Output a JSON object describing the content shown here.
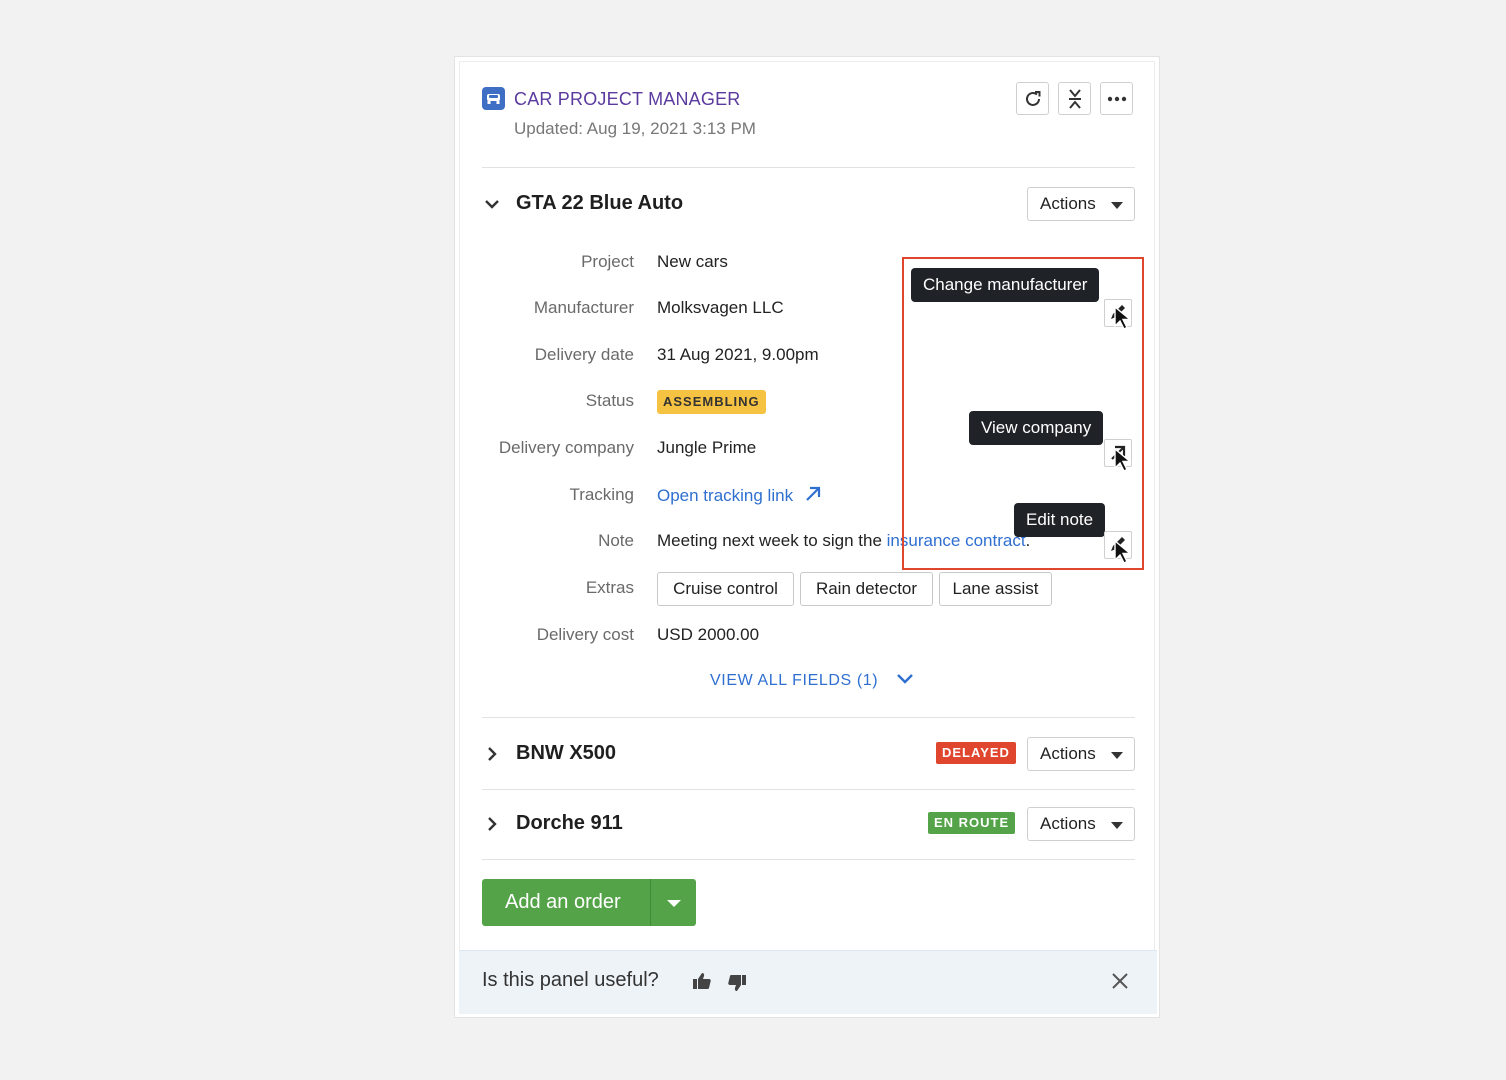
{
  "header": {
    "app_title": "CAR PROJECT MANAGER",
    "updated": "Updated: Aug 19, 2021 3:13 PM",
    "icons": [
      "car-icon",
      "refresh-icon",
      "collapse-icon",
      "more-icon"
    ]
  },
  "orders": [
    {
      "title": "GTA 22 Blue Auto",
      "expanded": true,
      "actions_label": "Actions",
      "fields": {
        "project": {
          "label": "Project",
          "value": "New cars"
        },
        "manufacturer": {
          "label": "Manufacturer",
          "value": "Molksvagen LLC"
        },
        "delivery_date": {
          "label": "Delivery date",
          "value": "31 Aug 2021, 9.00pm"
        },
        "status": {
          "label": "Status",
          "value": "ASSEMBLING",
          "color": "#f5c242"
        },
        "delivery_company": {
          "label": "Delivery company",
          "value": "Jungle Prime"
        },
        "tracking": {
          "label": "Tracking",
          "value": "Open tracking link"
        },
        "note": {
          "label": "Note",
          "value_prefix": "Meeting next week to sign the ",
          "link": "insurance contract",
          "suffix": "."
        },
        "extras": {
          "label": "Extras",
          "chips": [
            "Cruise control",
            "Rain detector",
            "Lane assist"
          ]
        },
        "delivery_cost": {
          "label": "Delivery cost",
          "value": "USD 2000.00"
        }
      },
      "view_all": "VIEW ALL FIELDS (1)"
    },
    {
      "title": "BNW X500",
      "expanded": false,
      "badge": "DELAYED",
      "badge_color": "#e0452d",
      "actions_label": "Actions"
    },
    {
      "title": "Dorche 911",
      "expanded": false,
      "badge": "EN ROUTE",
      "badge_color": "#55a349",
      "actions_label": "Actions"
    }
  ],
  "add_order": {
    "label": "Add an order"
  },
  "tooltips": {
    "change_manufacturer": "Change manufacturer",
    "view_company": "View company",
    "edit_note": "Edit note"
  },
  "footer": {
    "question": "Is this panel useful?",
    "icons": [
      "thumbs-up-icon",
      "thumbs-down-icon",
      "close-icon"
    ]
  },
  "colors": {
    "accent_purple": "#5b3a9e",
    "link_blue": "#2f6fd0",
    "highlight_red": "#e0452d",
    "primary_green": "#55a349"
  }
}
